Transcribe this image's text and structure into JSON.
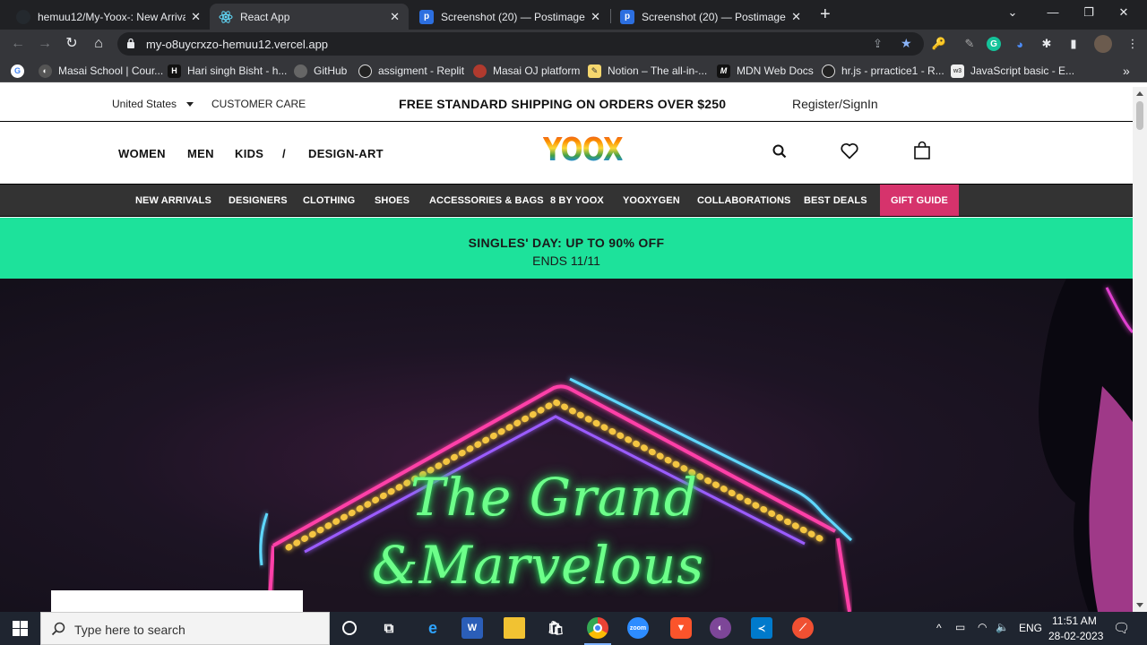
{
  "browser": {
    "tabs": [
      {
        "title": "hemuu12/My-Yoox-: New Arrival",
        "icon": "github-icon"
      },
      {
        "title": "React App",
        "icon": "react-icon"
      },
      {
        "title": "Screenshot (20) — Postimages",
        "icon": "postimages-icon"
      },
      {
        "title": "Screenshot (20) — Postimages",
        "icon": "postimages-icon"
      }
    ],
    "new_tab": "+",
    "url": "my-o8uycrxzo-hemuu12.vercel.app",
    "bookmarks": [
      {
        "label": "Masai School | Cour...",
        "icon": "masai-icon"
      },
      {
        "label": "Hari singh Bisht - h...",
        "icon": "hashnode-icon"
      },
      {
        "label": "GitHub",
        "icon": "github-icon"
      },
      {
        "label": "assigment - Replit",
        "icon": "replit-icon"
      },
      {
        "label": "Masai OJ platform",
        "icon": "masai-oj-icon"
      },
      {
        "label": "Notion – The all-in-...",
        "icon": "notion-icon"
      },
      {
        "label": "MDN Web Docs",
        "icon": "mdn-icon"
      },
      {
        "label": "hr.js - prractice1 - R...",
        "icon": "replit-icon"
      },
      {
        "label": "JavaScript basic - E...",
        "icon": "w3-icon"
      }
    ]
  },
  "site": {
    "country": "United States",
    "customer_care": "CUSTOMER CARE",
    "shipping": "FREE STANDARD SHIPPING ON ORDERS OVER $250",
    "register": "Register/SignIn",
    "main_nav": [
      "WOMEN",
      "MEN",
      "KIDS",
      "/",
      "DESIGN-ART"
    ],
    "logo": "YOOX",
    "categories": [
      "NEW ARRIVALS",
      "DESIGNERS",
      "CLOTHING",
      "SHOES",
      "ACCESSORIES & BAGS",
      "8 BY YOOX",
      "YOOXYGEN",
      "COLLABORATIONS",
      "BEST DEALS"
    ],
    "gift_guide": "GIFT GUIDE",
    "promo_line1": "SINGLES' DAY: UP TO 90% OFF",
    "promo_line2": "ENDS 11/11",
    "hero_line1": "The Grand",
    "hero_line2": "&Marvelous",
    "colors": {
      "promo": "#1de29b",
      "gift": "#d6336c",
      "catbar": "#333333",
      "neon_green": "#6dff8a",
      "neon_pink": "#ff3fa8"
    }
  },
  "taskbar": {
    "search_placeholder": "Type here to search",
    "language": "ENG",
    "time": "11:51 AM",
    "date": "28-02-2023"
  }
}
